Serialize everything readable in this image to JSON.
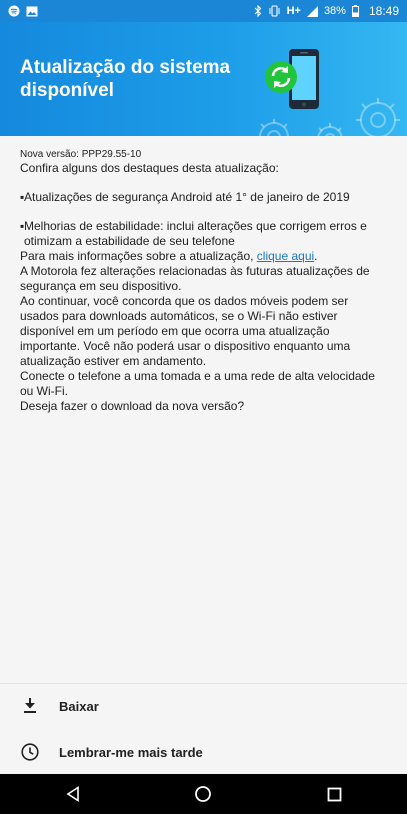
{
  "status_bar": {
    "network_label": "H+",
    "battery_percent": "38%",
    "time": "18:49",
    "icons": [
      "spotify-icon",
      "image-icon",
      "bluetooth-icon",
      "vibrate-icon",
      "signal-icon",
      "battery-icon"
    ]
  },
  "header": {
    "title": "Atualização do sistema disponível",
    "colors": {
      "start": "#1589dd",
      "end": "#35b7f2"
    },
    "art_icons": [
      "phone-icon",
      "sync-icon",
      "gear-icon"
    ]
  },
  "content": {
    "version": "Nova versão: PPP29.55-10",
    "intro": "Confira alguns dos destaques desta atualização:",
    "bullets": [
      "Atualizações de segurança Android até 1° de janeiro de 2019",
      "Melhorias de estabilidade: inclui alterações que corrigem erros e otimizam a estabilidade de seu telefone"
    ],
    "more_info_prefix": "Para mais informações sobre a atualização, ",
    "more_info_link": "clique aqui",
    "more_info_suffix": ".",
    "motorola_notice": "A Motorola fez alterações relacionadas às futuras atualizações de segurança em seu dispositivo.",
    "data_notice": "Ao continuar, você concorda que os dados móveis podem ser usados para downloads automáticos, se o Wi-Fi não estiver disponível em um período em que ocorra uma atualização importante. Você não poderá usar o dispositivo enquanto uma atualização estiver em andamento.",
    "power_notice": "Conecte o telefone a uma tomada e a uma rede de alta velocidade ou Wi-Fi.",
    "question": "Deseja fazer o download da nova versão?"
  },
  "actions": {
    "download_label": "Baixar",
    "download_icon": "download-icon",
    "remind_label": "Lembrar-me mais tarde",
    "remind_icon": "clock-icon"
  },
  "nav": {
    "buttons": [
      "back-icon",
      "home-icon",
      "recents-icon"
    ]
  },
  "colors": {
    "status_bar": "#1b86d6",
    "link": "#1976d2",
    "background": "#f5f5f5",
    "sync_badge": "#21c43a"
  }
}
